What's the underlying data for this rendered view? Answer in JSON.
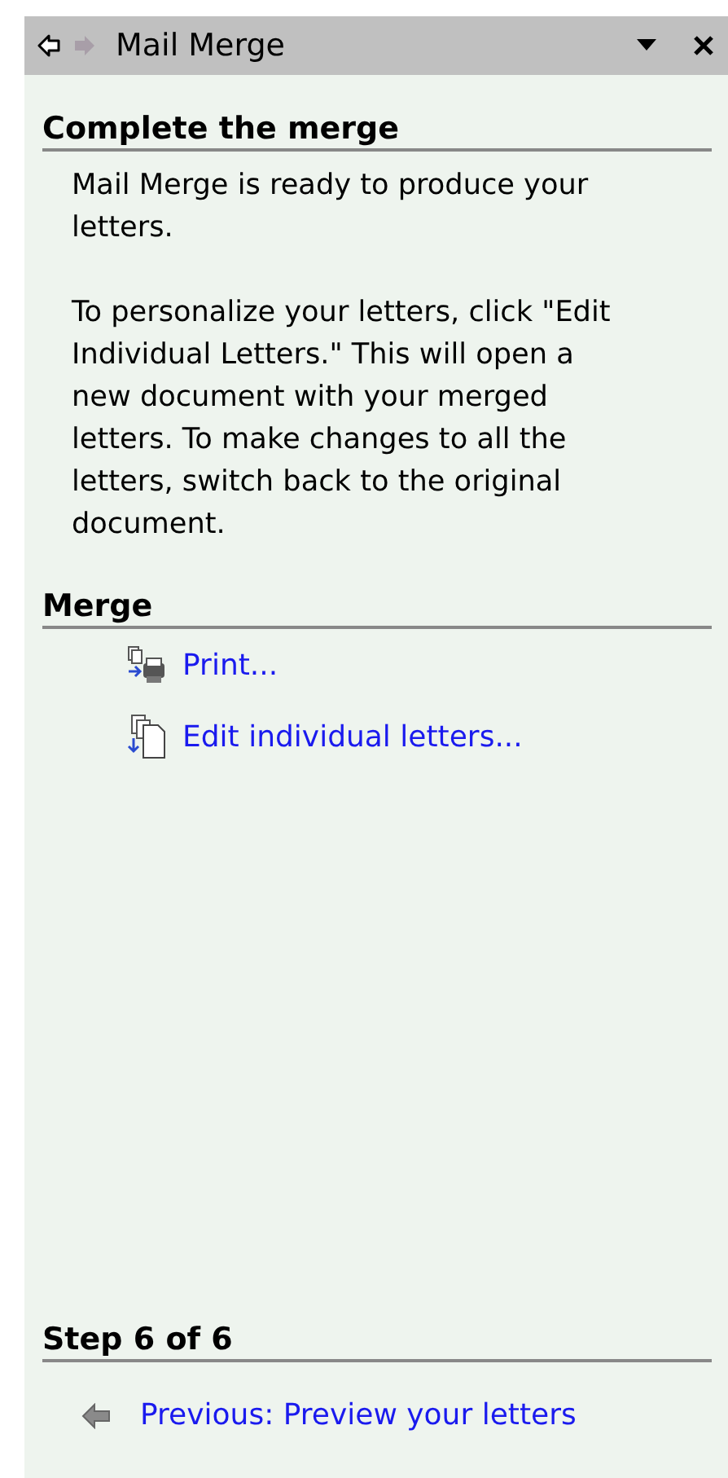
{
  "title_bar": {
    "title": "Mail Merge",
    "back": {
      "disabled": false
    },
    "forward": {
      "disabled": true
    }
  },
  "sections": [
    {
      "heading": "Complete the merge",
      "paragraphs": [
        "Mail Merge is ready to produce your letters.",
        "To personalize your letters, click \"Edit Individual Letters.\" This will open a new document with your merged letters. To make changes to all the letters, switch back to the original document."
      ]
    },
    {
      "heading": "Merge",
      "links": [
        {
          "kind": "print",
          "label": "Print..."
        },
        {
          "kind": "edit",
          "label": "Edit individual letters..."
        }
      ]
    }
  ],
  "footer": {
    "heading": "Step 6 of 6",
    "link": {
      "label": "Previous: Preview your letters"
    }
  }
}
